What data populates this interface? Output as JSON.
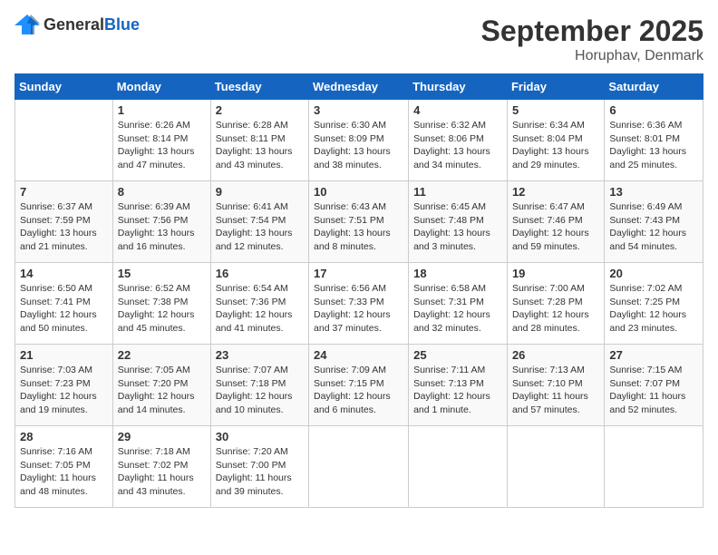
{
  "header": {
    "logo_general": "General",
    "logo_blue": "Blue",
    "title": "September 2025",
    "subtitle": "Horuphav, Denmark"
  },
  "calendar": {
    "days_of_week": [
      "Sunday",
      "Monday",
      "Tuesday",
      "Wednesday",
      "Thursday",
      "Friday",
      "Saturday"
    ],
    "weeks": [
      [
        {
          "day": "",
          "info": ""
        },
        {
          "day": "1",
          "info": "Sunrise: 6:26 AM\nSunset: 8:14 PM\nDaylight: 13 hours\nand 47 minutes."
        },
        {
          "day": "2",
          "info": "Sunrise: 6:28 AM\nSunset: 8:11 PM\nDaylight: 13 hours\nand 43 minutes."
        },
        {
          "day": "3",
          "info": "Sunrise: 6:30 AM\nSunset: 8:09 PM\nDaylight: 13 hours\nand 38 minutes."
        },
        {
          "day": "4",
          "info": "Sunrise: 6:32 AM\nSunset: 8:06 PM\nDaylight: 13 hours\nand 34 minutes."
        },
        {
          "day": "5",
          "info": "Sunrise: 6:34 AM\nSunset: 8:04 PM\nDaylight: 13 hours\nand 29 minutes."
        },
        {
          "day": "6",
          "info": "Sunrise: 6:36 AM\nSunset: 8:01 PM\nDaylight: 13 hours\nand 25 minutes."
        }
      ],
      [
        {
          "day": "7",
          "info": "Sunrise: 6:37 AM\nSunset: 7:59 PM\nDaylight: 13 hours\nand 21 minutes."
        },
        {
          "day": "8",
          "info": "Sunrise: 6:39 AM\nSunset: 7:56 PM\nDaylight: 13 hours\nand 16 minutes."
        },
        {
          "day": "9",
          "info": "Sunrise: 6:41 AM\nSunset: 7:54 PM\nDaylight: 13 hours\nand 12 minutes."
        },
        {
          "day": "10",
          "info": "Sunrise: 6:43 AM\nSunset: 7:51 PM\nDaylight: 13 hours\nand 8 minutes."
        },
        {
          "day": "11",
          "info": "Sunrise: 6:45 AM\nSunset: 7:48 PM\nDaylight: 13 hours\nand 3 minutes."
        },
        {
          "day": "12",
          "info": "Sunrise: 6:47 AM\nSunset: 7:46 PM\nDaylight: 12 hours\nand 59 minutes."
        },
        {
          "day": "13",
          "info": "Sunrise: 6:49 AM\nSunset: 7:43 PM\nDaylight: 12 hours\nand 54 minutes."
        }
      ],
      [
        {
          "day": "14",
          "info": "Sunrise: 6:50 AM\nSunset: 7:41 PM\nDaylight: 12 hours\nand 50 minutes."
        },
        {
          "day": "15",
          "info": "Sunrise: 6:52 AM\nSunset: 7:38 PM\nDaylight: 12 hours\nand 45 minutes."
        },
        {
          "day": "16",
          "info": "Sunrise: 6:54 AM\nSunset: 7:36 PM\nDaylight: 12 hours\nand 41 minutes."
        },
        {
          "day": "17",
          "info": "Sunrise: 6:56 AM\nSunset: 7:33 PM\nDaylight: 12 hours\nand 37 minutes."
        },
        {
          "day": "18",
          "info": "Sunrise: 6:58 AM\nSunset: 7:31 PM\nDaylight: 12 hours\nand 32 minutes."
        },
        {
          "day": "19",
          "info": "Sunrise: 7:00 AM\nSunset: 7:28 PM\nDaylight: 12 hours\nand 28 minutes."
        },
        {
          "day": "20",
          "info": "Sunrise: 7:02 AM\nSunset: 7:25 PM\nDaylight: 12 hours\nand 23 minutes."
        }
      ],
      [
        {
          "day": "21",
          "info": "Sunrise: 7:03 AM\nSunset: 7:23 PM\nDaylight: 12 hours\nand 19 minutes."
        },
        {
          "day": "22",
          "info": "Sunrise: 7:05 AM\nSunset: 7:20 PM\nDaylight: 12 hours\nand 14 minutes."
        },
        {
          "day": "23",
          "info": "Sunrise: 7:07 AM\nSunset: 7:18 PM\nDaylight: 12 hours\nand 10 minutes."
        },
        {
          "day": "24",
          "info": "Sunrise: 7:09 AM\nSunset: 7:15 PM\nDaylight: 12 hours\nand 6 minutes."
        },
        {
          "day": "25",
          "info": "Sunrise: 7:11 AM\nSunset: 7:13 PM\nDaylight: 12 hours\nand 1 minute."
        },
        {
          "day": "26",
          "info": "Sunrise: 7:13 AM\nSunset: 7:10 PM\nDaylight: 11 hours\nand 57 minutes."
        },
        {
          "day": "27",
          "info": "Sunrise: 7:15 AM\nSunset: 7:07 PM\nDaylight: 11 hours\nand 52 minutes."
        }
      ],
      [
        {
          "day": "28",
          "info": "Sunrise: 7:16 AM\nSunset: 7:05 PM\nDaylight: 11 hours\nand 48 minutes."
        },
        {
          "day": "29",
          "info": "Sunrise: 7:18 AM\nSunset: 7:02 PM\nDaylight: 11 hours\nand 43 minutes."
        },
        {
          "day": "30",
          "info": "Sunrise: 7:20 AM\nSunset: 7:00 PM\nDaylight: 11 hours\nand 39 minutes."
        },
        {
          "day": "",
          "info": ""
        },
        {
          "day": "",
          "info": ""
        },
        {
          "day": "",
          "info": ""
        },
        {
          "day": "",
          "info": ""
        }
      ]
    ]
  }
}
